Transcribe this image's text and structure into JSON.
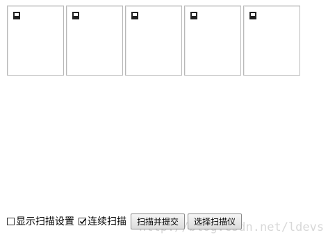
{
  "thumbnails": [
    {
      "icon": "document-icon"
    },
    {
      "icon": "document-icon"
    },
    {
      "icon": "document-icon"
    },
    {
      "icon": "document-icon"
    },
    {
      "icon": "document-icon"
    }
  ],
  "controls": {
    "show_settings": {
      "label": "显示扫描设置",
      "checked": false
    },
    "continuous_scan": {
      "label": "连续扫描",
      "checked": true
    },
    "scan_submit_label": "扫描并提交",
    "select_scanner_label": "选择扫描仪"
  },
  "watermark": "http://blog.csdn.net/ldevs"
}
